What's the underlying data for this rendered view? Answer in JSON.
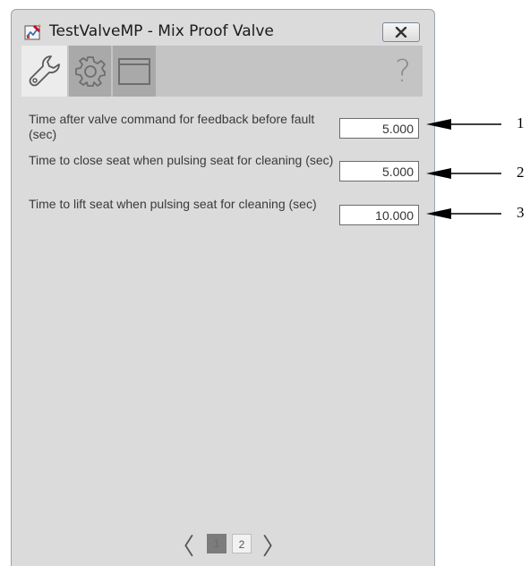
{
  "window": {
    "title": "TestValveMP - Mix Proof Valve"
  },
  "toolbar": {
    "tabs": [
      {
        "icon": "wrench-icon"
      },
      {
        "icon": "gear-icon"
      },
      {
        "icon": "window-icon"
      }
    ],
    "help": "?"
  },
  "params": [
    {
      "label": "Time after valve command for feedback before fault (sec)",
      "value": "5.000"
    },
    {
      "label": "Time to close seat when pulsing seat for cleaning (sec)",
      "value": "5.000"
    },
    {
      "label": "Time to lift seat when pulsing seat for cleaning (sec)",
      "value": "10.000"
    }
  ],
  "pager": {
    "prev": "〈",
    "next": "〉",
    "pages": [
      "1",
      "2"
    ]
  },
  "callouts": [
    "1",
    "2",
    "3"
  ]
}
